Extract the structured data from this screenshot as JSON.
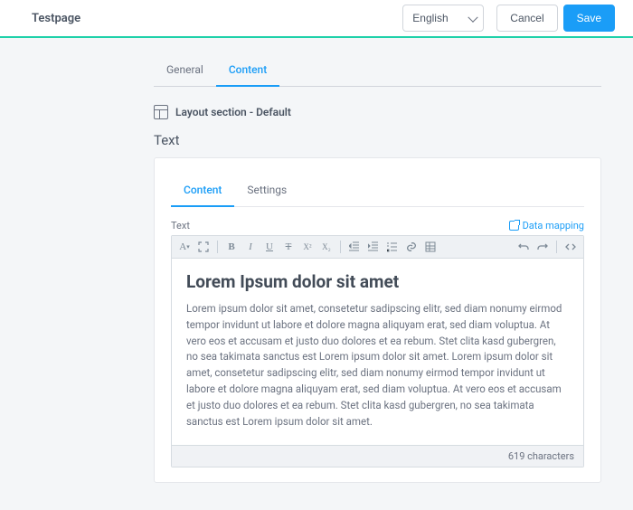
{
  "header": {
    "title": "Testpage",
    "language": "English",
    "language_options": [
      "English"
    ],
    "cancel": "Cancel",
    "save": "Save"
  },
  "tabs": {
    "general": "General",
    "content": "Content"
  },
  "section": {
    "title": "Layout section - Default"
  },
  "widget": {
    "label": "Text"
  },
  "card": {
    "tab_content": "Content",
    "tab_settings": "Settings",
    "field_label": "Text",
    "data_mapping": "Data mapping",
    "body_heading": "Lorem Ipsum dolor sit amet",
    "body_text": "Lorem ipsum dolor sit amet, consetetur sadipscing elitr, sed diam nonumy eirmod tempor invidunt ut labore et dolore magna aliquyam erat, sed diam voluptua. At vero eos et accusam et justo duo dolores et ea rebum. Stet clita kasd gubergren, no sea takimata sanctus est Lorem ipsum dolor sit amet. Lorem ipsum dolor sit amet, consetetur sadipscing elitr, sed diam nonumy eirmod tempor invidunt ut labore et dolore magna aliquyam erat, sed diam voluptua. At vero eos et accusam et justo duo dolores et ea rebum. Stet clita kasd gubergren, no sea takimata sanctus est Lorem ipsum dolor sit amet.",
    "char_count": "619 characters"
  },
  "toolbar": {
    "font": "A",
    "bold": "B",
    "italic": "I",
    "underline": "U",
    "strike": "T",
    "sup": "X²",
    "sub": "X₂"
  }
}
